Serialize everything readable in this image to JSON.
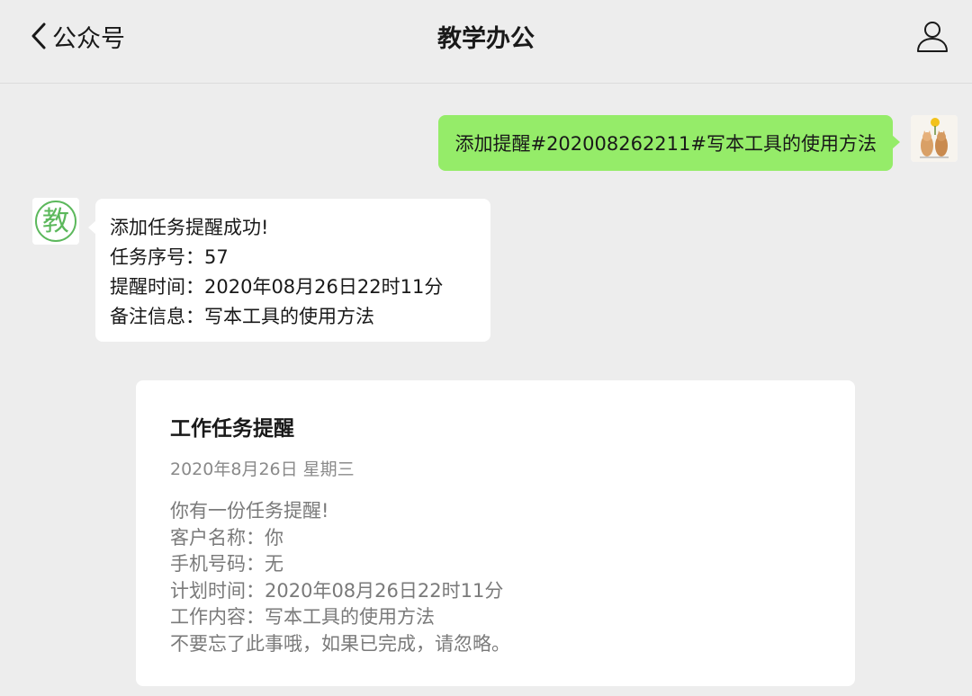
{
  "header": {
    "back_label": "公众号",
    "title": "教学办公"
  },
  "messages": {
    "outgoing": "添加提醒#202008262211#写本工具的使用方法",
    "bot_reply": [
      "添加任务提醒成功!",
      "任务序号：57",
      "提醒时间：2020年08月26日22时11分",
      "备注信息：写本工具的使用方法"
    ]
  },
  "card": {
    "title": "工作任务提醒",
    "date": "2020年8月26日 星期三",
    "lines": [
      "你有一份任务提醒!",
      "客户名称：你",
      "手机号码：无",
      "计划时间：2020年08月26日22时11分",
      "工作内容：写本工具的使用方法",
      "不要忘了此事哦，如果已完成，请忽略。"
    ]
  },
  "bot_avatar_glyph": "教",
  "colors": {
    "background": "#ededed",
    "outgoing_bubble": "#95ec69",
    "incoming_bubble": "#ffffff",
    "bot_avatar_stroke": "#5cb85c"
  },
  "icons": {
    "back": "chevron-left-icon",
    "profile": "person-icon"
  }
}
